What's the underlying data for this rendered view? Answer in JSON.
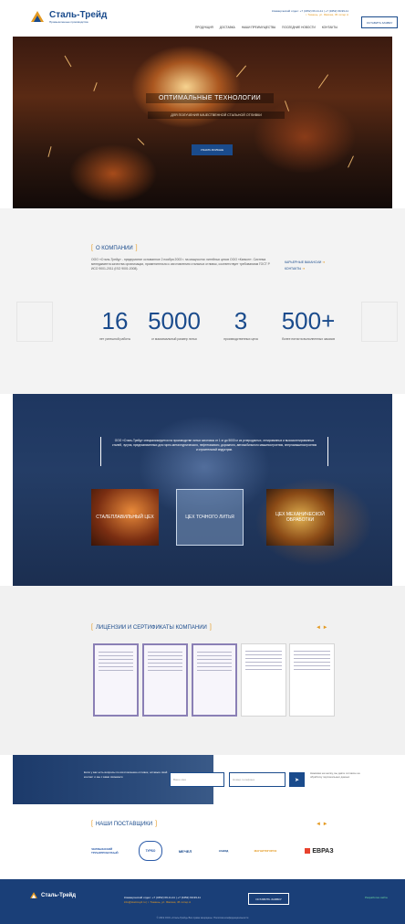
{
  "brand": {
    "name": "Сталь-Трейд",
    "tagline": "Промышленные производства"
  },
  "header": {
    "contact_line1": "Коммерческий отдел:  +7 (3452) 69-11-11  |  +7 (3452) 69-99-11",
    "contact_line2": "г. Тюмень, ул. Ямская, 45 литер А",
    "nav": [
      "ПРОДУКЦИЯ",
      "ДОСТАВКА",
      "НАШИ ПРЕИМУЩЕСТВА",
      "ПОСЛЕДНИЕ НОВОСТИ",
      "КОНТАКТЫ"
    ],
    "callback_label": "ОСТАВИТЬ ЗАЯВКУ"
  },
  "hero": {
    "title": "ОПТИМАЛЬНЫЕ ТЕХНОЛОГИИ",
    "subtitle": "ДЛЯ ПОЛУЧЕНИЯ КАЧЕСТВЕННОЙ СТАЛЬНОЙ ОТЛИВКИ",
    "button": "УЗНАТЬ БОЛЬШЕ"
  },
  "about": {
    "title": "О КОМПАНИИ",
    "text": "ООО «Сталь-Трейд» - предприятие основанное 2 ноября 2003 г. на мощностях литейных цехов ООО «Канкон». Система менеджмента качества организации, применительно к изготовлению стальных отливок, соответствует требованиям ГОСТ Р ИСО 9001-2011 (ISO 9001:2008).",
    "links": [
      "КАРЬЕРНЫЕ ВАКАНСИИ",
      "КОНТАКТЫ"
    ],
    "stats": [
      {
        "value": "16",
        "label": "лет успешной работы"
      },
      {
        "value": "5000",
        "label": "кг максимальный размер литья"
      },
      {
        "value": "3",
        "label": "производственных цеха"
      },
      {
        "value": "500+",
        "label": "более пятиста выполненных заказов"
      }
    ]
  },
  "production": {
    "text": "ООО «Сталь-Трейд» специализируется на производстве литых заготовок от 1 кг до 5000 кг из углеродистых, легированных и высоколегированных сталей, чугуна, предназначенных для горно-металлургического, нефтегазового, дорожного, автомобильного машиностроения, энергомашиностроения и строительной индустрии.",
    "cards": [
      "СТАЛЕПЛАВИЛЬНЫЙ ЦЕХ",
      "ЦЕХ ТОЧНОГО ЛИТЬЯ",
      "ЦЕХ МЕХАНИЧЕСКОЙ ОБРАБОТКИ"
    ]
  },
  "licenses": {
    "title": "ЛИЦЕНЗИИ И СЕРТИФИКАТЫ КОМПАНИИ",
    "count": 5
  },
  "subscribe": {
    "text": "Если у вас есть вопросы по изготовлению отливок, оставьте свой контакт и мы с вами свяжемся",
    "name_placeholder": "Ваше имя",
    "phone_placeholder": "Номер телефона",
    "send": "➤",
    "note": "Нажимая на кнопку, вы даёте согласие на обработку персональных данных"
  },
  "suppliers": {
    "title": "НАШИ ПОСТАВЩИКИ",
    "logos": [
      "ЧЕЛЯБИНСКИЙ ТРУБОПРОКАТНЫЙ",
      "ТУРБО",
      "МЕЧЕЛ",
      "ЗАВОД",
      "МАГНИТОГОРСК",
      "ЕВРАЗ"
    ]
  },
  "footer": {
    "contact_line1": "Коммерческий отдел:  +7 (3452) 69-11-11  |  +7 (3452) 69-99-11",
    "contact_line2": "info@stal-treyd.ru  |  г. Тюмень, ул. Ямская, 45 литер А",
    "button": "ОСТАВИТЬ ЗАЯВКУ",
    "developer": "Разработка сайта",
    "copyright": "© 2019 ООО «Сталь-Трейд» Все права защищены. Политика конфиденциальности"
  }
}
